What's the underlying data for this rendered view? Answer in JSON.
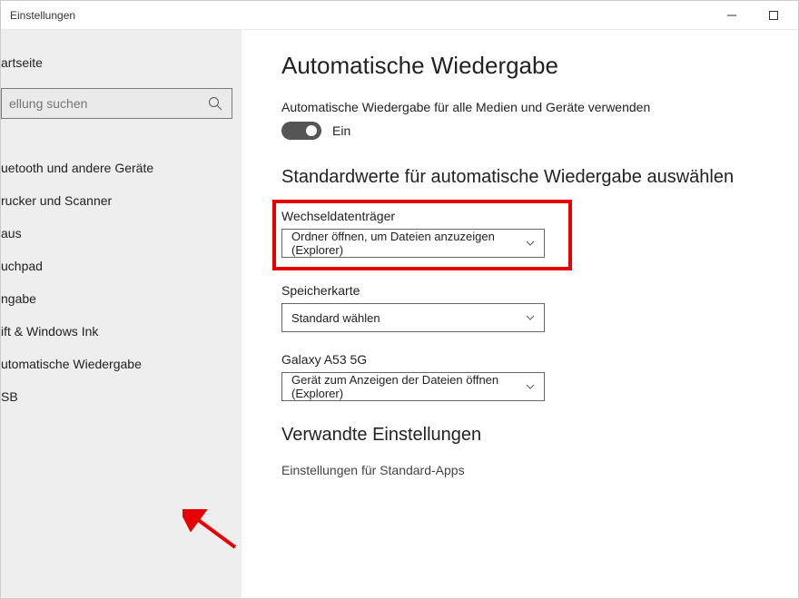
{
  "window": {
    "title": "Einstellungen"
  },
  "sidebar": {
    "home": "artseite",
    "searchPlaceholder": "ellung suchen",
    "items": [
      {
        "label": "uetooth und andere Geräte"
      },
      {
        "label": "rucker und Scanner"
      },
      {
        "label": "aus"
      },
      {
        "label": "uchpad"
      },
      {
        "label": "ngabe"
      },
      {
        "label": "ift & Windows Ink"
      },
      {
        "label": "utomatische Wiedergabe"
      },
      {
        "label": "SB"
      }
    ]
  },
  "content": {
    "pageTitle": "Automatische Wiedergabe",
    "toggleDescription": "Automatische Wiedergabe für alle Medien und Geräte verwenden",
    "toggleState": "Ein",
    "sectionTitle": "Standardwerte für automatische Wiedergabe auswählen",
    "settings": [
      {
        "label": "Wechseldatenträger",
        "value": "Ordner öffnen, um Dateien anzuzeigen (Explorer)",
        "highlighted": true
      },
      {
        "label": "Speicherkarte",
        "value": "Standard wählen"
      },
      {
        "label": "Galaxy A53 5G",
        "value": "Gerät zum Anzeigen der Dateien öffnen (Explorer)"
      }
    ],
    "relatedTitle": "Verwandte Einstellungen",
    "relatedLink": "Einstellungen für Standard-Apps"
  }
}
